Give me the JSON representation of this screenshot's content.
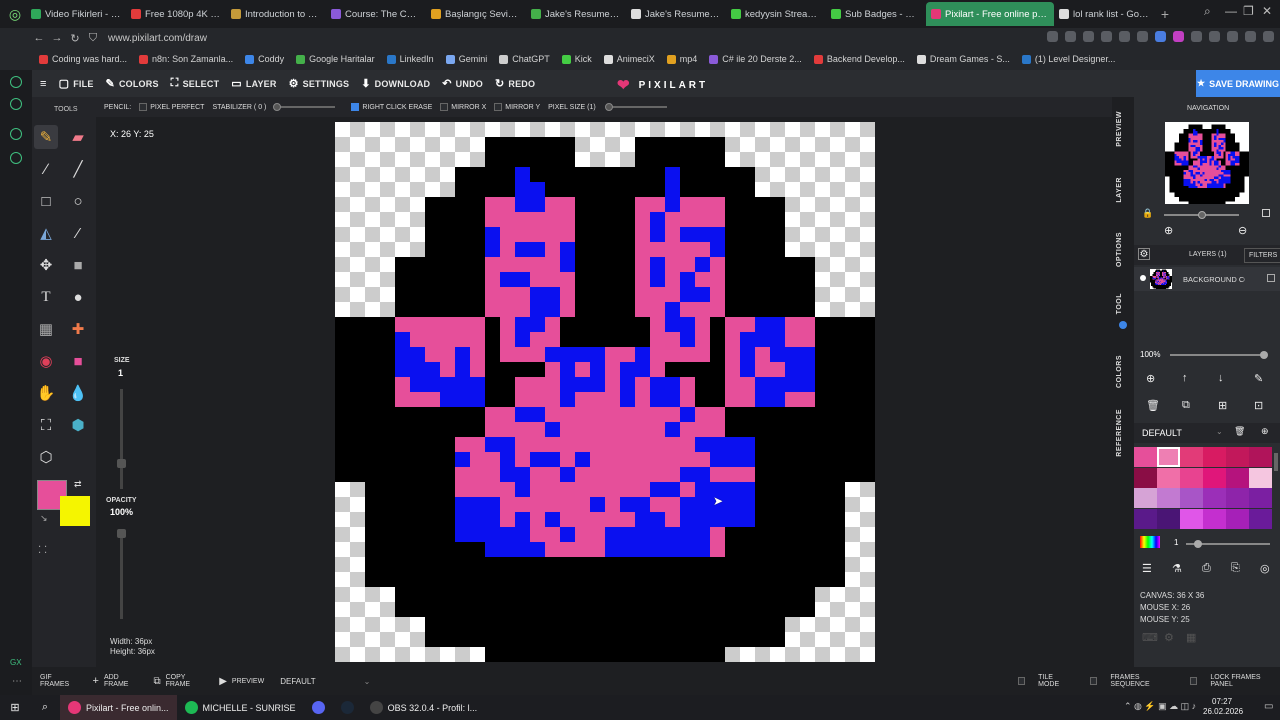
{
  "browser": {
    "tabs": [
      {
        "title": "Video Fikirleri - Go",
        "color": "#2fa85a"
      },
      {
        "title": "Free 1080p 4K You",
        "color": "#e23b3b"
      },
      {
        "title": "Introduction to We",
        "color": "#c49a3a"
      },
      {
        "title": "Course: The Comp",
        "color": "#8a5ad8"
      },
      {
        "title": "Başlangıç Seviyes",
        "color": "#e0a020"
      },
      {
        "title": "Jake's Resume - F",
        "color": "#44b04a"
      },
      {
        "title": "Jake's Resume - G",
        "color": "#dddddd"
      },
      {
        "title": "kedyysin Stream -",
        "color": "#44cc44"
      },
      {
        "title": "Sub Badges - Kick",
        "color": "#44cc44"
      },
      {
        "title": "Pixilart - Free online pixel",
        "color": "#e53777",
        "active": true
      },
      {
        "title": "lol rank list - Goog",
        "color": "#dddddd"
      }
    ],
    "new_tab": "+",
    "url": "www.pixilart.com/draw",
    "bookmarks": [
      {
        "label": "Coding was hard...",
        "color": "#e23b3b"
      },
      {
        "label": "n8n: Son Zamanla...",
        "color": "#e23b3b"
      },
      {
        "label": "Coddy",
        "color": "#3d86e8"
      },
      {
        "label": "Google Haritalar",
        "color": "#44b04a"
      },
      {
        "label": "LinkedIn",
        "color": "#2a77c8"
      },
      {
        "label": "Gemini",
        "color": "#7aa7f0"
      },
      {
        "label": "ChatGPT",
        "color": "#cccccc"
      },
      {
        "label": "Kick",
        "color": "#44cc44"
      },
      {
        "label": "AnimeciX",
        "color": "#dddddd"
      },
      {
        "label": "mp4",
        "color": "#e0a020"
      },
      {
        "label": "C# ile 20 Derste 2...",
        "color": "#8a5ad8"
      },
      {
        "label": "Backend Develop...",
        "color": "#e23b3b"
      },
      {
        "label": "Dream Games - S...",
        "color": "#dddddd"
      },
      {
        "label": "(1) Level Designer...",
        "color": "#2a77c8"
      }
    ]
  },
  "app": {
    "menu": [
      {
        "label": "FILE",
        "icon": "file-icon"
      },
      {
        "label": "COLORS",
        "icon": "brush-icon"
      },
      {
        "label": "SELECT",
        "icon": "select-icon"
      },
      {
        "label": "LAYER",
        "icon": "layer-icon"
      },
      {
        "label": "SETTINGS",
        "icon": "gear-icon"
      },
      {
        "label": "DOWNLOAD",
        "icon": "download-icon"
      },
      {
        "label": "UNDO",
        "icon": "undo-icon"
      },
      {
        "label": "REDO",
        "icon": "redo-icon"
      }
    ],
    "logo": "PIXILART",
    "save_label": "SAVE DRAWING",
    "toolbar": {
      "pencil_label": "PENCIL:",
      "pixel_perfect": "PIXEL PERFECT",
      "stabilizer": "STABILIZER ( 0 )",
      "right_click_erase": "RIGHT CLICK ERASE",
      "mirror_x": "MIRROR X",
      "mirror_y": "MIRROR Y",
      "pixel_size": "PIXEL SIZE (1)"
    },
    "tools_title": "TOOLS",
    "coordinates": "X: 26 Y: 25",
    "size_label": "SIZE",
    "size_value": "1",
    "opacity_label": "OPACITY",
    "opacity_value": "100%",
    "primary_color": "#e64f9a",
    "secondary_color": "#f5f500",
    "canvas_width": "Width: 36px",
    "canvas_height": "Height: 36px",
    "right_tabs": [
      "PREVIEW",
      "LAYER",
      "OPTIONS",
      "TOOL",
      "COLORS",
      "REFERENCE"
    ],
    "navigation_title": "NAVIGATION",
    "layers_title": "LAYERS (1)",
    "filters_label": "FILTERS",
    "layer_name": "BACKGROUND CO",
    "layer_opacity": "100%",
    "palette_name": "DEFAULT",
    "palette_colors": [
      "#e64f9a",
      "#ee7fb3",
      "#e23b78",
      "#d81b62",
      "#c2185b",
      "#b0145a",
      "#8a0d45",
      "#f06fa8",
      "#e84390",
      "#e0167a",
      "#b5137d",
      "#f5c6e0",
      "#d6a3d6",
      "#c27ad1",
      "#a855c7",
      "#9b2fb8",
      "#8e24aa",
      "#7b1fa2",
      "#5a1a8a",
      "#4a1575",
      "#e056e8",
      "#c42fcf",
      "#a620b8",
      "#6a1b9a"
    ],
    "palette_count": "1",
    "canvas_info": "CANVAS: 36 X 36",
    "mouse_x": "MOUSE X: 26",
    "mouse_y": "MOUSE Y: 25",
    "bottom": {
      "gif_frames": "GIF FRAMES",
      "add_frame": "ADD FRAME",
      "copy_frame": "COPY FRAME",
      "preview": "PREVIEW",
      "default": "DEFAULT",
      "tile_mode": "TILE MODE",
      "frames_sequence": "FRAMES SEQUENCE",
      "lock_frames": "LOCK FRAMES PANEL"
    }
  },
  "taskbar": {
    "items": [
      {
        "label": "Pixilart - Free onlin...",
        "color": "#e53777"
      },
      {
        "label": "MICHELLE - SUNRISE",
        "color": "#1db954"
      },
      {
        "label": "",
        "color": "#5865f2"
      },
      {
        "label": "",
        "color": "#1b2838"
      },
      {
        "label": "OBS 32.0.4 - Profil: l...",
        "color": "#444444"
      }
    ],
    "time": "07:27",
    "date": "26.02.2026"
  },
  "pixel_colors": {
    "black": "#000000",
    "pink": "#e64f9a",
    "blue": "#0a10f0"
  }
}
